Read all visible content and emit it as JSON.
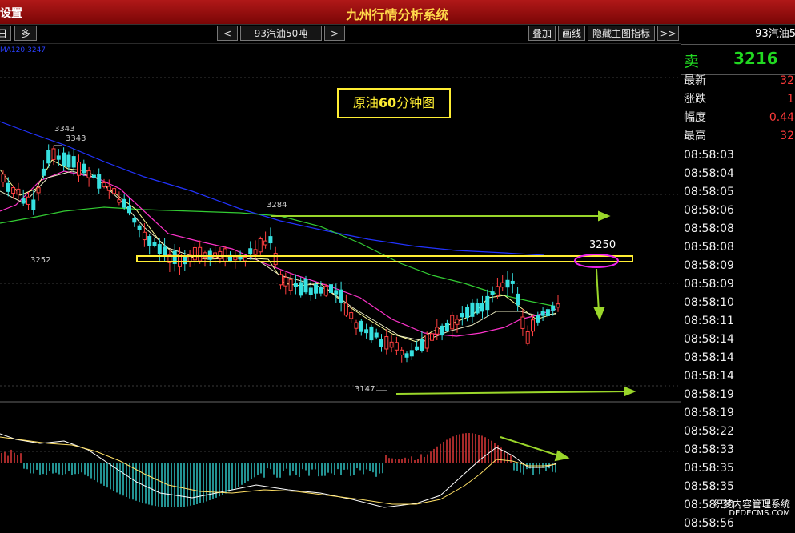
{
  "app": {
    "title_left": "设置",
    "title": "九州行情分析系统"
  },
  "toolbar": {
    "period_label": "日",
    "multi_label": "多",
    "prev_label": "<",
    "symbol_label": "93汽油50吨",
    "next_label": ">",
    "overlay_label": "叠加",
    "draw_label": "画线",
    "hide_indicator_label": "隐藏主图指标",
    "more_label": ">>"
  },
  "chart": {
    "ma_label": "MA120:3247",
    "annotation_prefix": "原油",
    "annotation_bold": "60",
    "annotation_suffix": "分钟图",
    "price_labels": [
      "3343",
      "3343",
      "3252",
      "3284",
      "3147"
    ],
    "level_label": "3250",
    "colors": {
      "up": "#ff4040",
      "down": "#36e0e0",
      "ma_short": "#ffff99",
      "ma_mid": "#ff33cc",
      "ma_long1": "#33cc33",
      "ma_long2": "#2233ff",
      "annotation": "#ffee33",
      "arrow": "#9ad62a",
      "circle": "#ee22ee"
    }
  },
  "quote": {
    "header": "93汽油5",
    "sell_label": "卖",
    "sell_price": "3216",
    "rows": [
      {
        "label": "最新",
        "value": "32"
      },
      {
        "label": "涨跌",
        "value": "1"
      },
      {
        "label": "幅度",
        "value": "0.44"
      },
      {
        "label": "最高",
        "value": "32"
      }
    ],
    "times": [
      "08:58:03",
      "08:58:04",
      "08:58:05",
      "08:58:06",
      "08:58:08",
      "08:58:08",
      "08:58:09",
      "08:58:09",
      "08:58:10",
      "08:58:11",
      "08:58:14",
      "08:58:14",
      "08:58:14",
      "08:58:19",
      "08:58:19",
      "08:58:22",
      "08:58:33",
      "08:58:35",
      "08:58:35",
      "08:58:50",
      "08:58:56"
    ]
  },
  "watermark": {
    "line1": "织梦内容管理系统",
    "line2": "DEDECMS.COM"
  }
}
